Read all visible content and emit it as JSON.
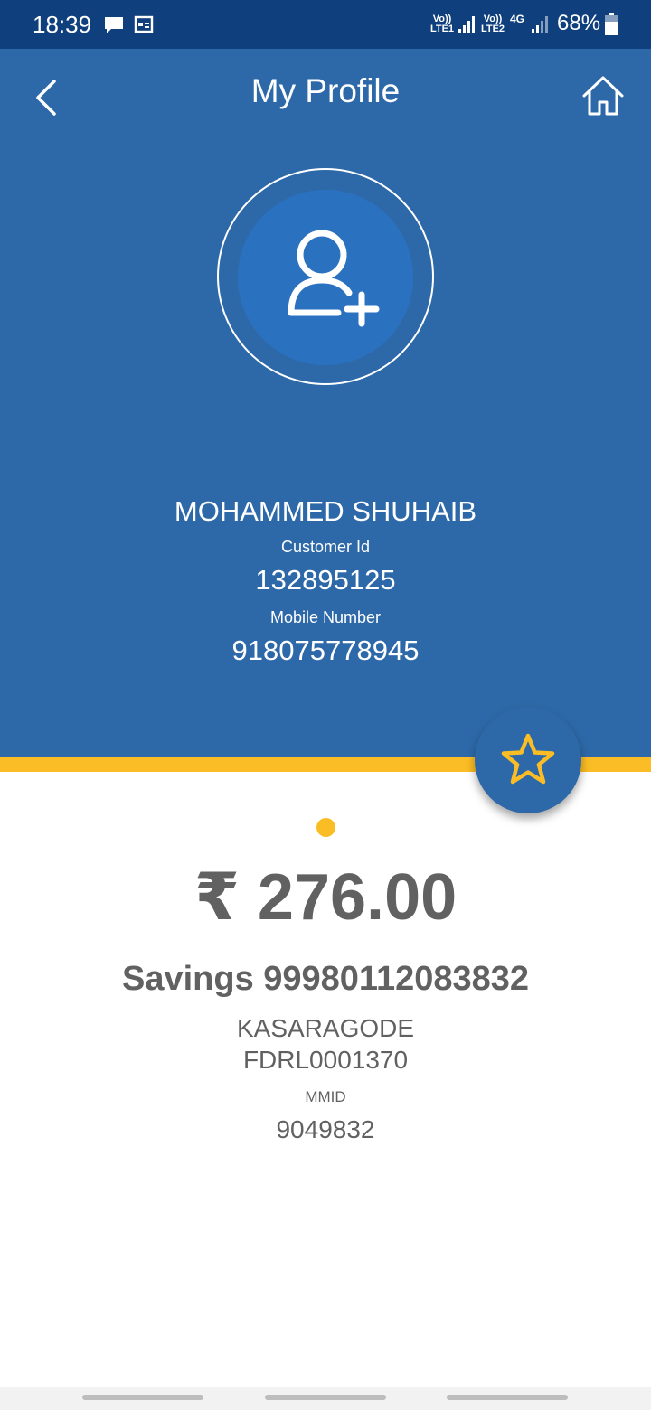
{
  "status_bar": {
    "time": "18:39",
    "sim1_label": "Vo)) LTE1",
    "sim2_label": "Vo)) LTE2",
    "network": "4G",
    "battery": "68%",
    "icons": [
      "message-icon",
      "calendar-icon",
      "signal-icon",
      "battery-icon"
    ]
  },
  "header": {
    "title": "My Profile",
    "back_icon": "chevron-left-icon",
    "home_icon": "home-icon"
  },
  "profile": {
    "avatar_icon": "add-user-icon",
    "name": "MOHAMMED SHUHAIB",
    "customer_id_label": "Customer Id",
    "customer_id": "132895125",
    "mobile_label": "Mobile Number",
    "mobile": "918075778945"
  },
  "favorite_icon": "star-icon",
  "account": {
    "balance": "₹ 276.00",
    "account_line": "Savings 99980112083832",
    "branch": "KASARAGODE",
    "ifsc": "FDRL0001370",
    "mmid_label": "MMID",
    "mmid": "9049832"
  },
  "colors": {
    "status_bar": "#0f3f7c",
    "header": "#2d69a8",
    "avatar": "#2a72c0",
    "accent": "#fbbd26",
    "text_dark": "#616161"
  }
}
